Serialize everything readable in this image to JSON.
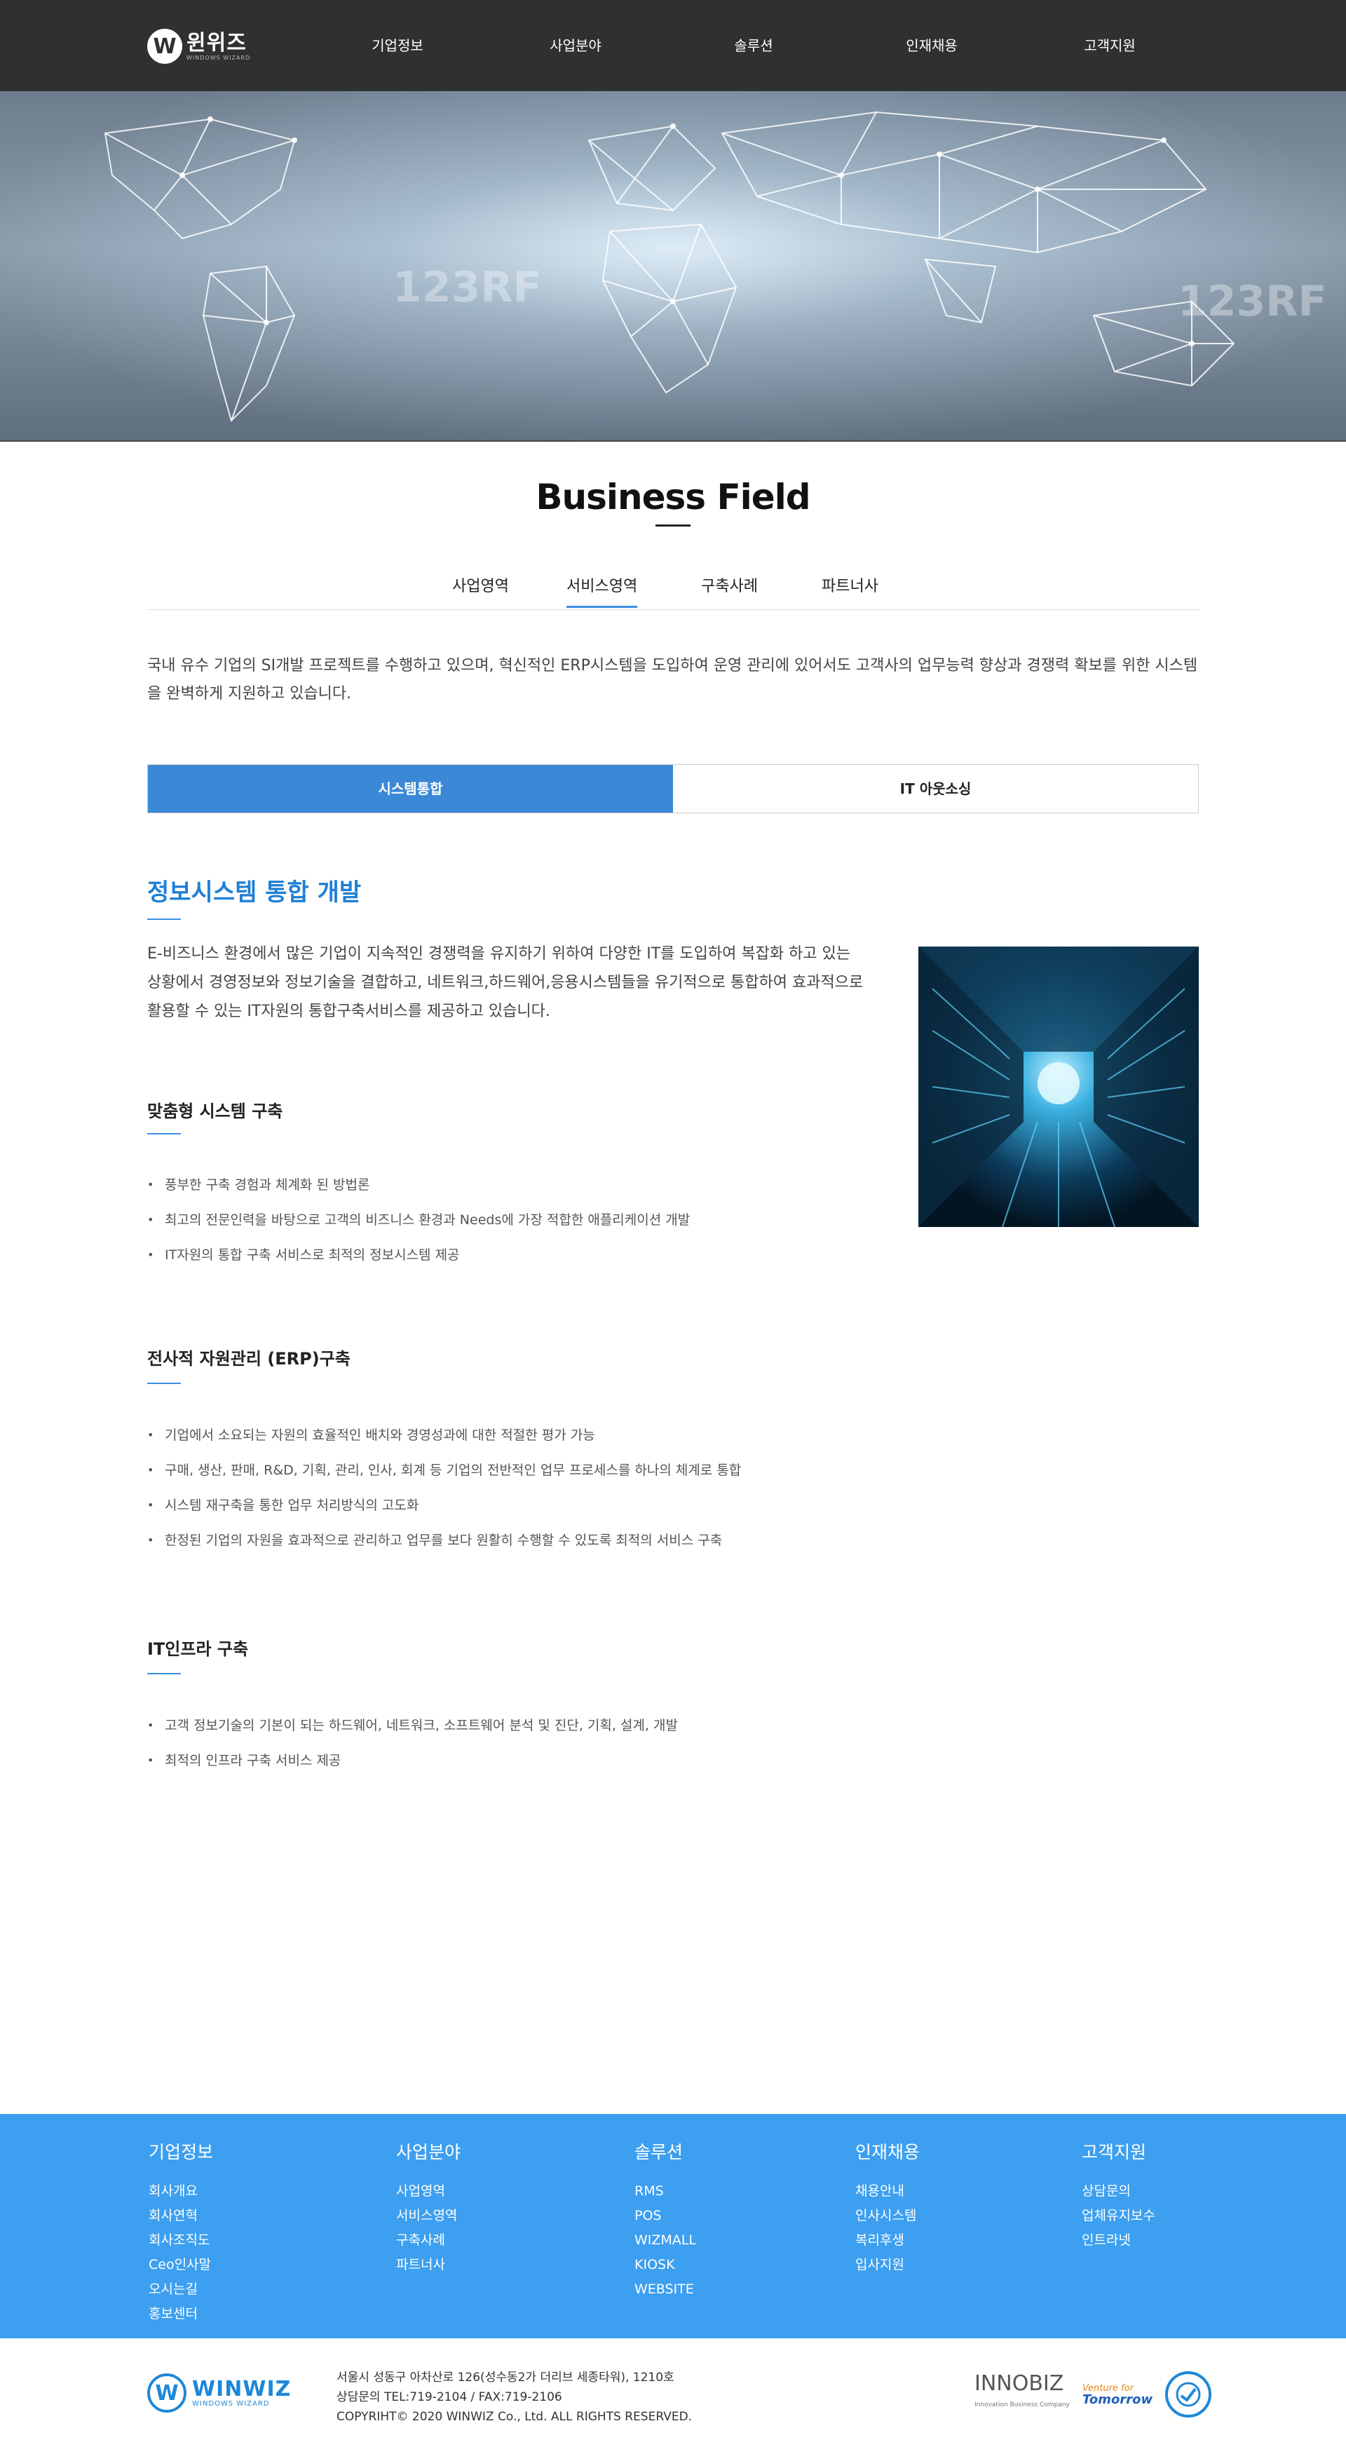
{
  "header": {
    "logo_mark": "W",
    "logo_name": "윈위즈",
    "logo_sub": "WINDOWS WIZARD",
    "nav": [
      "기업정보",
      "사업분야",
      "솔루션",
      "인재채용",
      "고객지원"
    ]
  },
  "hero": {
    "watermark": "123RF"
  },
  "page": {
    "title": "Business Field",
    "subtabs": [
      "사업영역",
      "서비스영역",
      "구축사례",
      "파트너사"
    ],
    "active_subtab": "서비스영역",
    "intro": "국내 유수 기업의 SI개발 프로젝트를 수행하고 있으며, 혁신적인 ERP시스템을 도입하여  운영 관리에 있어서도 고객사의 업무능력 향상과 경쟁력 확보를 위한 시스템을 완벽하게 지원하고 있습니다."
  },
  "content_tabs": [
    "시스템통합",
    "IT 아웃소싱"
  ],
  "active_content_tab": "시스템통합",
  "section": {
    "title": "정보시스템 통합 개발",
    "description": "E-비즈니스 환경에서 많은 기업이 지속적인 경쟁력을 유지하기 위하여 다양한 IT를 도입하여 복잡화 하고 있는 상황에서 경영정보와 정보기술을 결합하고, 네트워크,하드웨어,응용시스템들을 유기적으로 통합하여 효과적으로 활용할 수 있는 IT자원의 통합구축서비스를 제공하고 있습니다.",
    "subsections": [
      {
        "title": "맞춤형 시스템 구축",
        "items": [
          "풍부한 구축 경험과 체계화 된 방법론",
          "최고의 전문인력을 바탕으로 고객의 비즈니스 환경과 Needs에 가장 적합한 애플리케이션 개발",
          " IT자원의 통합 구축 서비스로 최적의 정보시스템 제공"
        ]
      },
      {
        "title": "전사적 자원관리 (ERP)구축",
        "items": [
          "기업에서 소요되는 자원의 효율적인 배치와 경영성과에 대한 적절한 평가 가능",
          "구매, 생산, 판매, R&D, 기획, 관리, 인사, 회계 등 기업의 전반적인 업무 프로세스를 하나의 체계로 통합",
          "시스템 재구축을 통한 업무 처리방식의 고도화",
          "한정된 기업의 자원을 효과적으로 관리하고 업무를 보다 원활히 수행할 수 있도록 최적의 서비스 구축"
        ]
      },
      {
        "title": "IT인프라 구축",
        "items": [
          "고객 정보기술의 기본이 되는 하드웨어, 네트워크,  소프트웨어 분석 및 진단, 기획, 설계, 개발",
          "최적의 인프라 구축 서비스 제공"
        ]
      }
    ]
  },
  "footer": {
    "columns": [
      {
        "heading": "기업정보",
        "links": [
          "회사개요",
          "회사연혁",
          "회사조직도",
          "Ceo인사말",
          "오시는길",
          "홍보센터"
        ]
      },
      {
        "heading": "사업분야",
        "links": [
          "사업영역",
          "서비스영역",
          "구축사례",
          "파트너사"
        ]
      },
      {
        "heading": "솔루션",
        "links": [
          "RMS",
          "POS",
          "WIZMALL",
          "KIOSK",
          "WEBSITE"
        ]
      },
      {
        "heading": "인재채용",
        "links": [
          "채용안내",
          "인사시스템",
          "복리후생",
          "입사지원"
        ]
      },
      {
        "heading": "고객지원",
        "links": [
          "상담문의",
          "업체유지보수",
          "인트라넷"
        ]
      }
    ],
    "logo_mark": "W",
    "logo_name": "WINWIZ",
    "logo_sub": "WINDOWS WIZARD",
    "address": "서울시 성동구 아차산로 126(성수동2가 더리브 세종타워), 1210호",
    "contact": "상담문의 TEL:719-2104 / FAX:719-2106",
    "copyright": "COPYRIHT© 2020 WINWIZ Co., Ltd. ALL RIGHTS RESERVED.",
    "badge_innobiz": "INNOBIZ",
    "badge_innobiz_sub": "Innovation Business Company",
    "badge_venture_top": "Venture for",
    "badge_venture_main": "Tomorrow"
  },
  "colors": {
    "accent": "#3b88d6",
    "header_bg": "#2f3032",
    "footer_bg": "#3d9ff0"
  }
}
